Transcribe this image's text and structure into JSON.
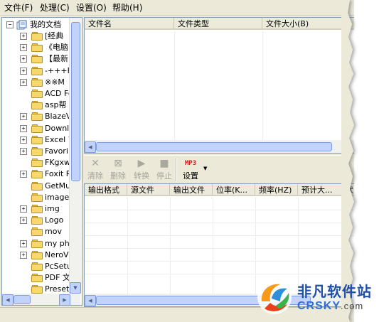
{
  "menu": {
    "items": [
      {
        "label": "文件(F)"
      },
      {
        "label": "处理(C)"
      },
      {
        "label": "设置(O)"
      },
      {
        "label": "帮助(H)"
      }
    ]
  },
  "tree": {
    "root_label": "我的文档",
    "items": [
      {
        "label": "[经典",
        "expander": "+"
      },
      {
        "label": "《电脑",
        "expander": "+"
      },
      {
        "label": "【最新",
        "expander": "+"
      },
      {
        "label": "-+++F",
        "expander": "+"
      },
      {
        "label": "※※M",
        "expander": "+"
      },
      {
        "label": "ACD Fo",
        "expander": ""
      },
      {
        "label": "asp帮",
        "expander": ""
      },
      {
        "label": "BlazeV",
        "expander": "+"
      },
      {
        "label": "Downlo",
        "expander": "+"
      },
      {
        "label": "Excel 7",
        "expander": "+"
      },
      {
        "label": "Favori",
        "expander": "+"
      },
      {
        "label": "FKgxw",
        "expander": ""
      },
      {
        "label": "Foxit R",
        "expander": "+"
      },
      {
        "label": "GetMu",
        "expander": ""
      },
      {
        "label": "images",
        "expander": ""
      },
      {
        "label": "img",
        "expander": "+"
      },
      {
        "label": "Logo",
        "expander": "+"
      },
      {
        "label": "mov",
        "expander": ""
      },
      {
        "label": "my pho",
        "expander": "+"
      },
      {
        "label": "NeroVi",
        "expander": "+"
      },
      {
        "label": "PcSetu",
        "expander": ""
      },
      {
        "label": "PDF 文",
        "expander": ""
      },
      {
        "label": "Preset",
        "expander": ""
      }
    ]
  },
  "file_list": {
    "columns": [
      {
        "label": "文件名"
      },
      {
        "label": "文件类型"
      },
      {
        "label": "文件大小(B)"
      }
    ]
  },
  "toolbar": {
    "clear_label": "清除",
    "delete_label": "删除",
    "convert_label": "转换",
    "stop_label": "停止",
    "settings_label": "设置",
    "mp3_badge": "MP3"
  },
  "output_list": {
    "columns": [
      {
        "label": "输出格式"
      },
      {
        "label": "源文件"
      },
      {
        "label": "输出文件"
      },
      {
        "label": "位率(K..."
      },
      {
        "label": "频率(HZ)"
      },
      {
        "label": "预计大..."
      },
      {
        "label": "状"
      }
    ]
  },
  "watermark": {
    "title": "非凡软件站",
    "domain_main": "CRSKY",
    "domain_suffix": ".com"
  },
  "icons": {
    "root": "documents-icon",
    "folder": "folder-icon",
    "clear": "x-icon",
    "delete": "delete-box-icon",
    "convert": "play-icon",
    "stop": "stop-square-icon",
    "settings": "mp3-badge-icon"
  },
  "colors": {
    "window_bg": "#ece9d8",
    "pane_border": "#7f9db9",
    "scroll_thumb": "#c2d3fb",
    "mp3_red": "#d42020"
  }
}
